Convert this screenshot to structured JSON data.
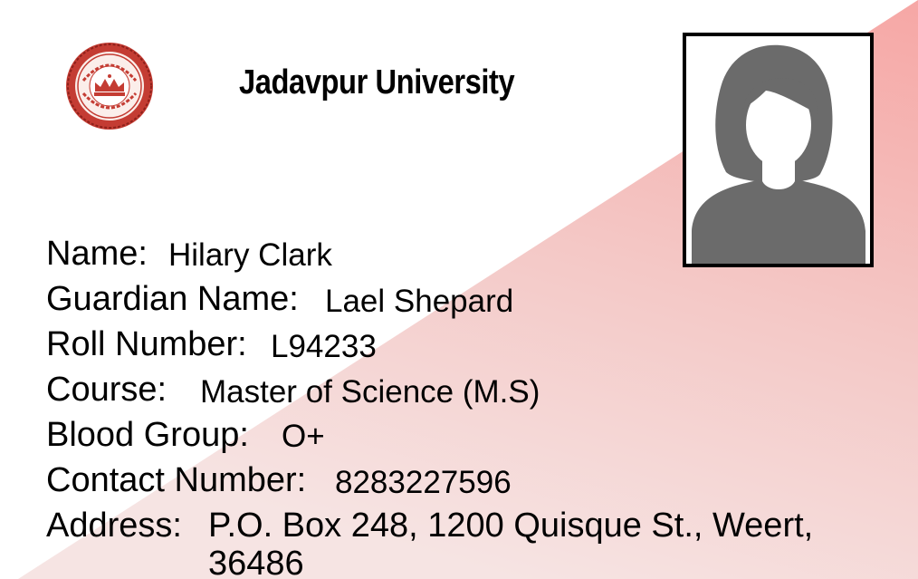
{
  "header": {
    "university_name": "Jadavpur University"
  },
  "student": {
    "name_label": "Name:",
    "name_value": "Hilary Clark",
    "guardian_label": "Guardian Name:",
    "guardian_value": "Lael Shepard",
    "roll_label": "Roll Number:",
    "roll_value": "L94233",
    "course_label": "Course:",
    "course_value": "Master of Science (M.S)",
    "blood_label": "Blood Group:",
    "blood_value": "O+",
    "contact_label": "Contact Number:",
    "contact_value": "8283227596",
    "address_label": "Address:",
    "address_value": "P.O. Box 248, 1200 Quisque St., Weert, 36486"
  },
  "icons": {
    "logo": "university-seal-icon",
    "photo": "person-silhouette-icon"
  },
  "colors": {
    "accent_pink": "#f4a9a8",
    "seal_red": "#b5332b",
    "silhouette_gray": "#6b6b6b"
  }
}
